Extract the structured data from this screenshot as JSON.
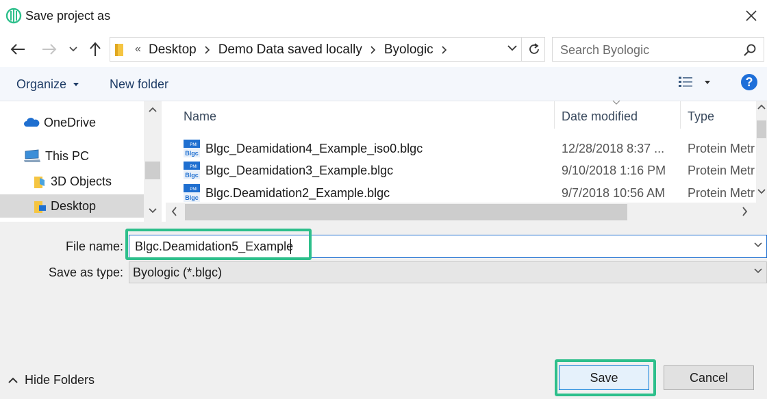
{
  "window": {
    "title": "Save project as"
  },
  "nav": {
    "breadcrumbs": [
      "Desktop",
      "Demo Data saved locally",
      "Byologic"
    ],
    "overflow_glyph": "«",
    "search_placeholder": "Search Byologic"
  },
  "toolbar": {
    "organize_label": "Organize",
    "new_folder_label": "New folder",
    "help_glyph": "?"
  },
  "nav_pane": {
    "items": [
      {
        "label": "OneDrive",
        "icon": "cloud-icon"
      },
      {
        "label": "This PC",
        "icon": "computer-icon"
      },
      {
        "label": "3D Objects",
        "icon": "folder-icon"
      },
      {
        "label": "Desktop",
        "icon": "desktop-folder-icon",
        "selected": true
      }
    ]
  },
  "file_list": {
    "columns": [
      "Name",
      "Date modified",
      "Type"
    ],
    "rows": [
      {
        "name": "Blgc_Deamidation4_Example_iso0.blgc",
        "date": "12/28/2018 8:37 ...",
        "type": "Protein Metr"
      },
      {
        "name": "Blgc_Deamidation3_Example.blgc",
        "date": "9/10/2018 1:16 PM",
        "type": "Protein Metr"
      },
      {
        "name": "Blgc.Deamidation2_Example.blgc",
        "date": "9/7/2018 10:56 AM",
        "type": "Protein Metr"
      }
    ],
    "file_icon_text": {
      "top": "PMI",
      "bottom": "Blgc"
    }
  },
  "form": {
    "file_name_label": "File name:",
    "file_name_value": "Blgc.Deamidation5_Example",
    "save_as_type_label": "Save as type:",
    "save_as_type_value": "Byologic (*.blgc)"
  },
  "footer": {
    "hide_folders_label": "Hide Folders",
    "save_label": "Save",
    "cancel_label": "Cancel"
  },
  "colors": {
    "highlight": "#2dbf8b",
    "accent": "#0078d7",
    "toolbar_text": "#1e3c66"
  }
}
